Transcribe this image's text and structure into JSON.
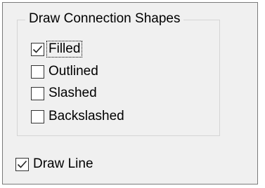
{
  "group": {
    "title": "Draw Connection Shapes",
    "options": [
      {
        "label": "Filled",
        "checked": true,
        "focused": true
      },
      {
        "label": "Outlined",
        "checked": false,
        "focused": false
      },
      {
        "label": "Slashed",
        "checked": false,
        "focused": false
      },
      {
        "label": "Backslashed",
        "checked": false,
        "focused": false
      }
    ]
  },
  "draw_line": {
    "label": "Draw Line",
    "checked": true
  }
}
